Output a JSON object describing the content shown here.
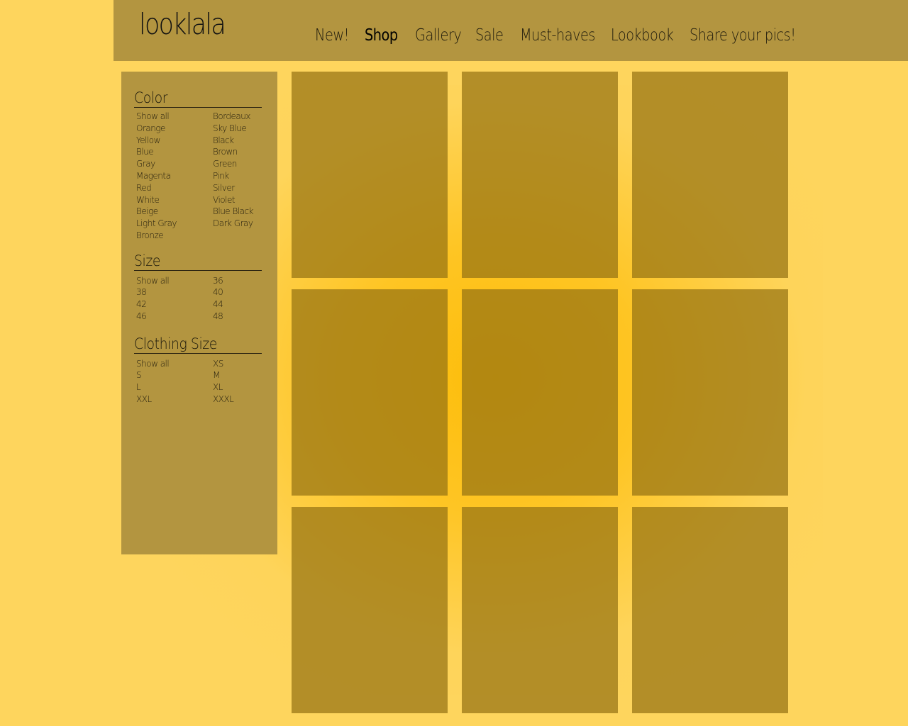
{
  "brand": {
    "logo_text": "looklala"
  },
  "nav": {
    "items": [
      {
        "label": "New!",
        "active": false
      },
      {
        "label": "Shop",
        "active": true
      },
      {
        "label": "Gallery",
        "active": false
      },
      {
        "label": "Sale",
        "active": false
      },
      {
        "label": "Must-haves",
        "active": false
      },
      {
        "label": "Lookbook",
        "active": false
      },
      {
        "label": "Share your pics!",
        "active": false
      }
    ]
  },
  "filters": {
    "color": {
      "title": "Color",
      "options": [
        "Show all",
        "Bordeaux",
        "Orange",
        "Sky Blue",
        "Yellow",
        "Black",
        "Blue",
        "Brown",
        "Gray",
        "Green",
        "Magenta",
        "Pink",
        "Red",
        "Silver",
        "White",
        "Violet",
        "Beige",
        "Blue Black",
        "Light Gray",
        "Dark Gray",
        "Bronze"
      ]
    },
    "size": {
      "title": "Size",
      "options": [
        "Show all",
        "36",
        "38",
        "40",
        "42",
        "44",
        "46",
        "48"
      ]
    },
    "clothing_size": {
      "title": "Clothing Size",
      "options": [
        "Show all",
        "XS",
        "S",
        "M",
        "L",
        "XL",
        "XXL",
        "XXXL"
      ]
    }
  },
  "products": {
    "count": 9
  },
  "colors": {
    "background": "#fed55d",
    "panel": "#b39540",
    "accent_glow": "#fdbd0a"
  }
}
